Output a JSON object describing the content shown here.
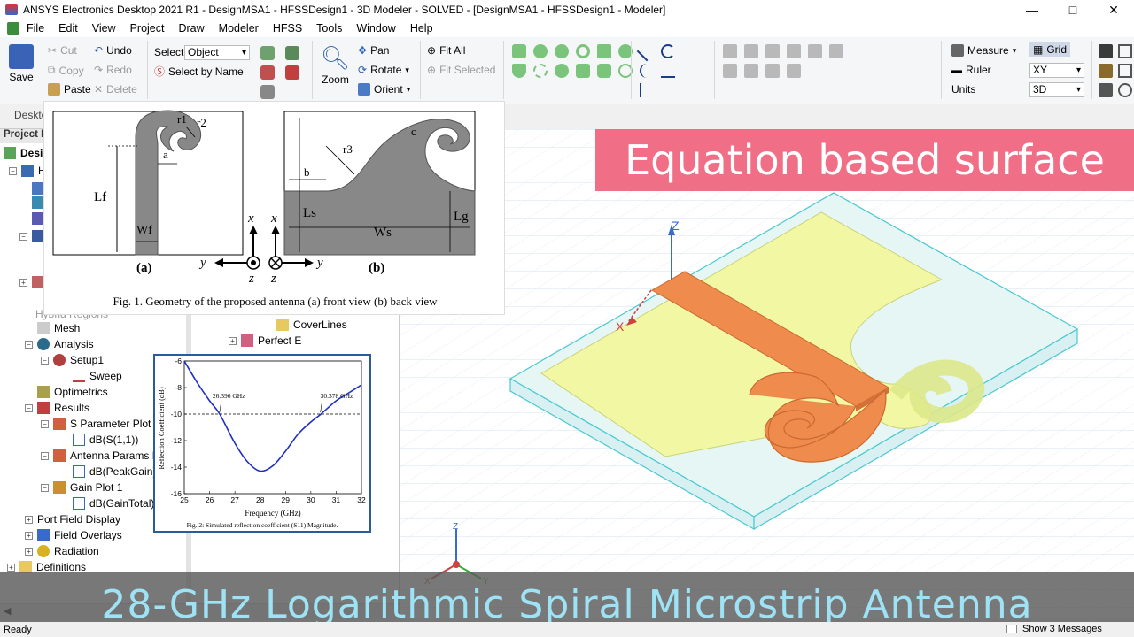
{
  "window": {
    "title": "ANSYS Electronics Desktop 2021 R1 - DesignMSA1 - HFSSDesign1 - 3D Modeler - SOLVED - [DesignMSA1 - HFSSDesign1 - Modeler]",
    "minimize": "—",
    "maximize": "□",
    "close": "✕"
  },
  "menu": [
    "File",
    "Edit",
    "View",
    "Project",
    "Draw",
    "Modeler",
    "HFSS",
    "Tools",
    "Window",
    "Help"
  ],
  "ribbon": {
    "save": "Save",
    "cut": "Cut",
    "copy": "Copy",
    "paste": "Paste",
    "undo": "Undo",
    "redo": "Redo",
    "delete": "Delete",
    "select_label": "Select:",
    "select_value": "Object",
    "select_by_name": "Select by Name",
    "zoom": "Zoom",
    "pan": "Pan",
    "rotate": "Rotate",
    "orient": "Orient",
    "fit_all": "Fit All",
    "fit_selected": "Fit Selected",
    "measure": "Measure",
    "ruler": "Ruler",
    "units": "Units",
    "grid": "Grid",
    "plane": "XY",
    "mode": "3D"
  },
  "desktop_tab": "Desktop",
  "project_manager_title": "Project M",
  "tree": {
    "root": "Desig",
    "hfss": "H",
    "mesh": "Mesh",
    "analysis": "Analysis",
    "setup": "Setup1",
    "sweep": "Sweep",
    "optimetrics": "Optimetrics",
    "results": "Results",
    "s_param_plot": "S Parameter Plot 1",
    "s11": "dB(S(1,1))",
    "antenna_params": "Antenna Params Plo",
    "peak_gain": "dB(PeakGain)",
    "gain_plot": "Gain Plot 1",
    "gain_total": "dB(GainTotal)",
    "port_field": "Port Field Display",
    "field_overlays": "Field Overlays",
    "radiation": "Radiation",
    "definitions": "Definitions",
    "hybrid_regions": "Hybrid Regions"
  },
  "tree2": {
    "cover_lines": "CoverLines",
    "perfect_e": "Perfect E"
  },
  "banner": "Equation based surface",
  "caption": "28-GHz Logarithmic Spiral Microstrip Antenna",
  "status": {
    "ready": "Ready",
    "messages": "Show 3 Messages"
  },
  "axes_viewport": {
    "z": "Z",
    "x": "X"
  },
  "triad": {
    "x": "X",
    "y": "Y",
    "z": "Z"
  },
  "fig1": {
    "caption": "Fig. 1. Geometry of the proposed antenna (a) front view (b) back view",
    "label_a": "(a)",
    "label_b": "(b)",
    "lf": "Lf",
    "wf": "Wf",
    "a": "a",
    "r1": "r1",
    "r2": "r2",
    "r3": "r3",
    "b": "b",
    "c": "c",
    "ls": "Ls",
    "lg": "Lg",
    "ws": "Ws",
    "x": "x",
    "y": "y",
    "z": "z"
  },
  "chart_data": {
    "type": "line",
    "title": "",
    "caption": "Fig. 2: Simulated reflection coefficient (S11) Magnitude.",
    "xlabel": "Frequency (GHz)",
    "ylabel": "Reflection Coefficient (dB)",
    "xlim": [
      25,
      32
    ],
    "ylim": [
      -16,
      -6
    ],
    "xticks": [
      25,
      26,
      27,
      28,
      29,
      30,
      31,
      32
    ],
    "yticks": [
      -6,
      -8,
      -10,
      -12,
      -14,
      -16
    ],
    "x": [
      25.0,
      25.5,
      26.0,
      26.4,
      27.0,
      27.5,
      28.0,
      28.5,
      29.0,
      29.5,
      30.0,
      30.4,
      31.0,
      31.5,
      32.0
    ],
    "y": [
      -6.0,
      -7.6,
      -9.0,
      -10.0,
      -12.2,
      -13.6,
      -14.3,
      -13.9,
      -12.8,
      -11.5,
      -10.6,
      -10.0,
      -9.0,
      -8.4,
      -7.8
    ],
    "reference_line": -10,
    "annotations": [
      "26.396 GHz",
      "30.378 GHz"
    ],
    "color": "#1f2fc0"
  }
}
